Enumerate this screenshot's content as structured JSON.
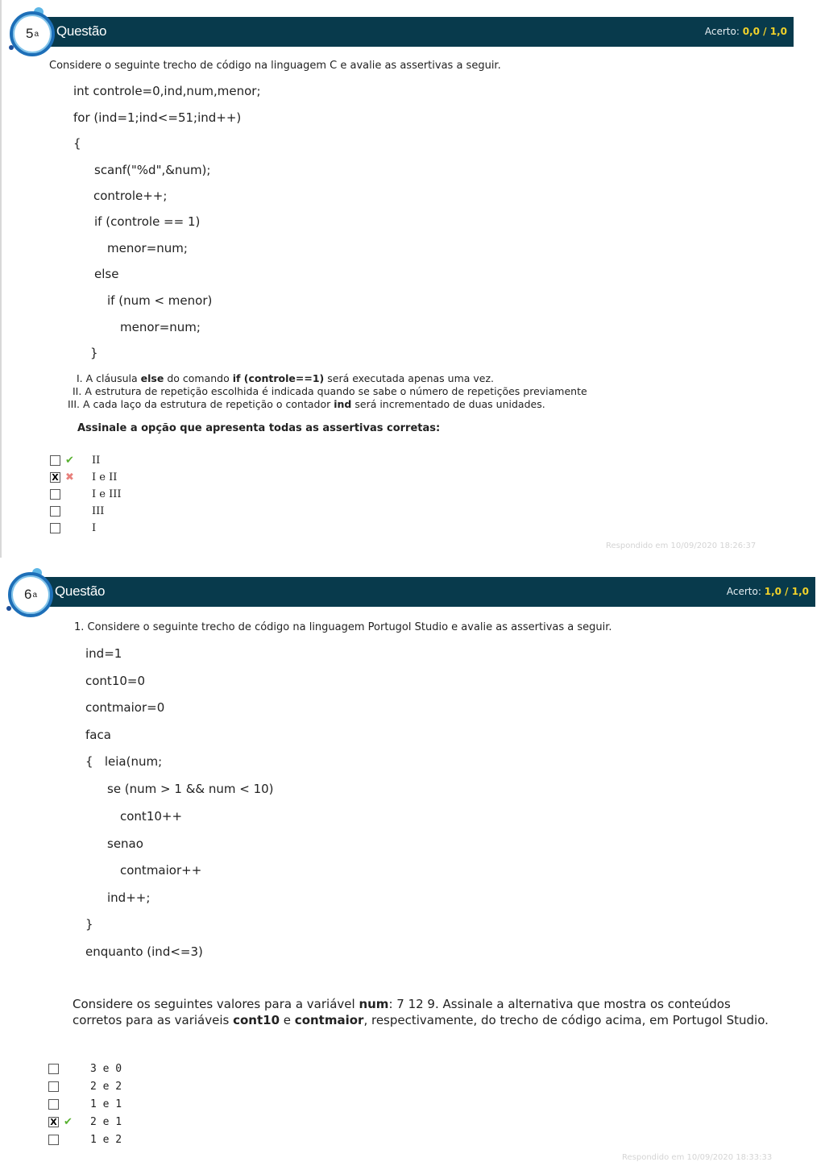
{
  "questions": [
    {
      "number": "5",
      "ordinal": "a",
      "title": "Questão",
      "score_label": "Acerto:",
      "score_value": "0,0",
      "score_sep": " / ",
      "score_max": "1,0",
      "prompt": "Considere o seguinte trecho de código na linguagem C e avalie as assertivas a seguir.",
      "code": [
        "int controle=0,ind,num,menor;",
        "for (ind=1;ind<=51;ind++)",
        "{",
        "scanf(\"%d\",&num);",
        "controle++;",
        "if (controle == 1)",
        "menor=num;",
        "else",
        "if (num < menor)",
        "menor=num;",
        "}"
      ],
      "assertions": [
        {
          "num": "I.",
          "parts": [
            "A cláusula ",
            "else",
            " do comando ",
            "if (controle==1)",
            " será executada apenas uma vez."
          ]
        },
        {
          "num": "II.",
          "parts": [
            "A estrutura de repetição escolhida é indicada quando se sabe o número de repetições previamente",
            "",
            "",
            "",
            ""
          ]
        },
        {
          "num": "III.",
          "parts": [
            "A cada laço da estrutura de repetição o contador ",
            "ind",
            " será incrementado de duas unidades.",
            "",
            ""
          ]
        }
      ],
      "instruction": "Assinale a opção que apresenta todas as assertivas corretas:",
      "options": [
        {
          "label": "II",
          "checked": false,
          "status": "correct"
        },
        {
          "label": "I e II",
          "checked": true,
          "status": "wrong"
        },
        {
          "label": "I e III",
          "checked": false,
          "status": ""
        },
        {
          "label": "III",
          "checked": false,
          "status": ""
        },
        {
          "label": "I",
          "checked": false,
          "status": ""
        }
      ],
      "answered_at": "Respondido em 10/09/2020 18:26:37"
    },
    {
      "number": "6",
      "ordinal": "a",
      "title": "Questão",
      "score_label": "Acerto:",
      "score_value": "1,0",
      "score_sep": " / ",
      "score_max": "1,0",
      "prompt": "1. Considere o seguinte trecho de código na linguagem Portugol Studio e avalie as assertivas a seguir.",
      "code": [
        "ind=1",
        "cont10=0",
        "contmaior=0",
        "faca",
        "{   leia(num;",
        "se (num > 1 && num < 10)",
        "cont10++",
        "senao",
        "contmaior++",
        "ind++;",
        "}",
        "enquanto (ind<=3)"
      ],
      "description_parts": [
        "Considere os seguintes valores para a variável ",
        "num",
        ": 7  12  9. Assinale a alternativa que mostra os conteúdos corretos para as variáveis ",
        "cont10",
        " e ",
        "contmaior",
        ", respectivamente, do trecho de código acima, em Portugol Studio."
      ],
      "options": [
        {
          "label": "3 e 0",
          "checked": false,
          "status": ""
        },
        {
          "label": "2 e 2",
          "checked": false,
          "status": ""
        },
        {
          "label": "1 e 1",
          "checked": false,
          "status": ""
        },
        {
          "label": "2 e 1",
          "checked": true,
          "status": "correct"
        },
        {
          "label": "1 e 2",
          "checked": false,
          "status": ""
        }
      ],
      "answered_at": "Respondido em 10/09/2020 18:33:33"
    }
  ],
  "icons": {
    "checked_box": "☒",
    "correct": "✔",
    "wrong": "✖"
  },
  "colors": {
    "header_bg": "#083a4c",
    "score_highlight": "#f2d22a",
    "correct": "#58b130",
    "wrong": "#e8807c",
    "badge_ring": "#1d6fb8"
  }
}
